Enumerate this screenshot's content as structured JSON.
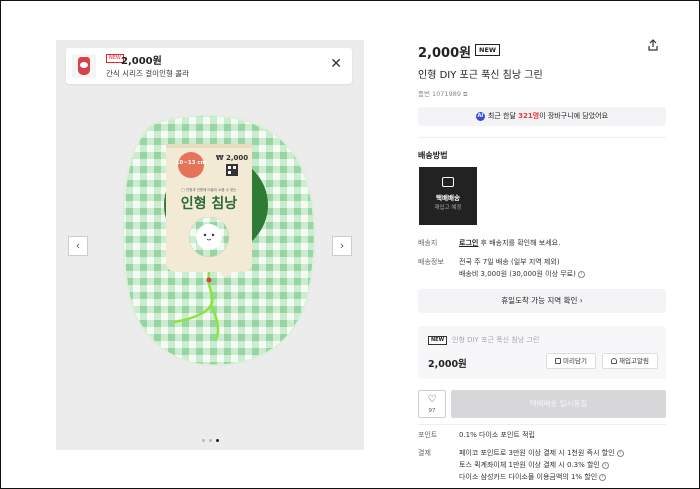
{
  "gallery": {
    "banner": {
      "tag": "NEW",
      "price": "2,000원",
      "name": "간식 시리즈 걸이인형 콜라",
      "close_glyph": "✕"
    },
    "prev_glyph": "‹",
    "next_glyph": "›",
    "package_label": {
      "price_tag": "₩ 2,000",
      "age_badge": "10~13 cm",
      "subtitle": "□ 인형과 인형에 어울리 소품 수 맞는",
      "title": "인형 침낭"
    }
  },
  "product": {
    "price": "2,000원",
    "new_badge": "NEW",
    "name": "인형 DIY 포근 푹신 침낭 그린",
    "number": "품번 1071989",
    "cart_bar": {
      "ai_label": "AI",
      "prefix": "최근 한달 ",
      "count": "321명",
      "suffix": "이 장바구니에 담았어요"
    },
    "delivery": {
      "section_label": "배송방법",
      "card_title": "택배배송",
      "card_sub": "재입고 예정"
    },
    "rows": {
      "region_label": "배송지",
      "region_login": "로그인",
      "region_text": " 후 배송지를 확인해 보세요.",
      "info_label": "배송정보",
      "info_line1": "전국 주 7일 배송 (일부 지역 제외)",
      "info_line2": "배송비 3,000원 (30,000원 이상 무료)"
    },
    "holiday_button": "휴일도착 가능 지역 확인 ›",
    "option": {
      "new_tag": "NEW",
      "name": "인형 DIY 포근 푹신 침낭 그린",
      "price": "2,000원",
      "preorder_button": "미리담기",
      "restock_button": "재입고알림"
    },
    "like_count": "97",
    "soldout_button": "택배배송 일시품절",
    "points_label": "포인트",
    "points_value": "0.1% 다이소 포인트 적립",
    "payment_label": "결제",
    "payment_lines": [
      "페이코 포인트로 3만원 이상 결제 시 1천원 즉시 할인",
      "토스 퀵계좌이체 1만원 이상 결제 시 0.3% 할인",
      "다이소 삼성카드 다이소몰 이용금액의 1% 할인"
    ]
  },
  "colors": {
    "ai_blue": "#3a4bd9",
    "highlight_red": "#e33333",
    "check_green": "#9fd8a8",
    "label_orange": "#e57358"
  }
}
